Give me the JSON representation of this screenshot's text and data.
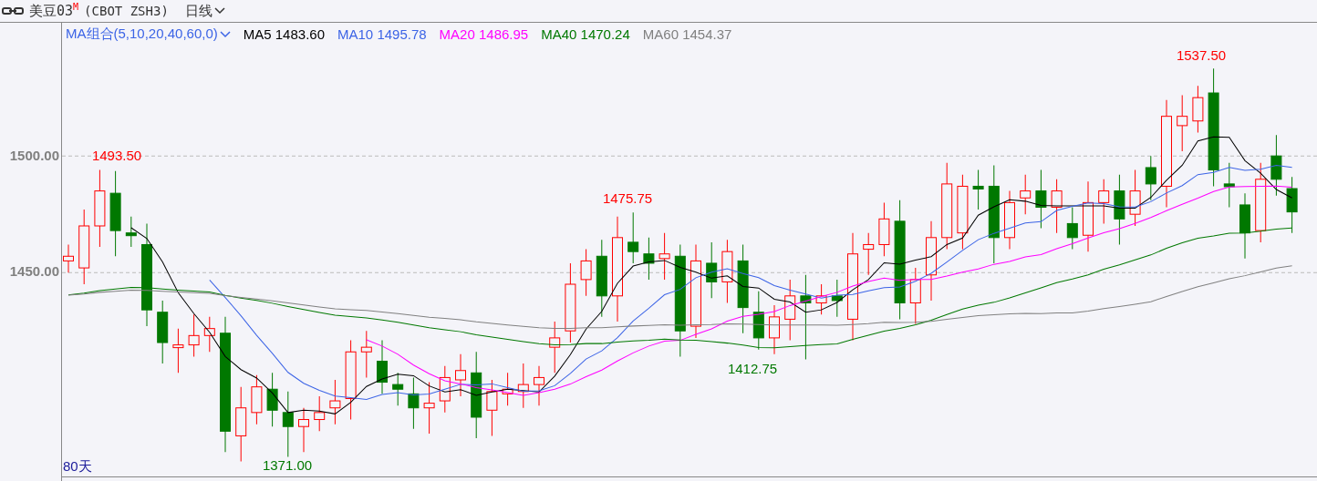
{
  "header": {
    "title": "美豆03$^{M}$",
    "code": "(CBOT ZSH3)",
    "period": "日线"
  },
  "ma_legend": {
    "label": "MA组合(5,10,20,40,60,0)",
    "items": [
      {
        "name": "MA5",
        "value": "1483.60",
        "color": "#000000"
      },
      {
        "name": "MA10",
        "value": "1495.78",
        "color": "#3c64e6"
      },
      {
        "name": "MA20",
        "value": "1486.95",
        "color": "#ff00ff"
      },
      {
        "name": "MA40",
        "value": "1470.24",
        "color": "#007800"
      },
      {
        "name": "MA60",
        "value": "1454.37",
        "color": "#808080"
      }
    ]
  },
  "axis": {
    "yticks": [
      "1500.00",
      "1450.00"
    ]
  },
  "annotations": [
    {
      "text": "1493.50",
      "kind": "high"
    },
    {
      "text": "1475.75",
      "kind": "high"
    },
    {
      "text": "1412.75",
      "kind": "low"
    },
    {
      "text": "1537.50",
      "kind": "high"
    },
    {
      "text": "1371.00",
      "kind": "low"
    }
  ],
  "footer": {
    "range": "80天"
  }
}
